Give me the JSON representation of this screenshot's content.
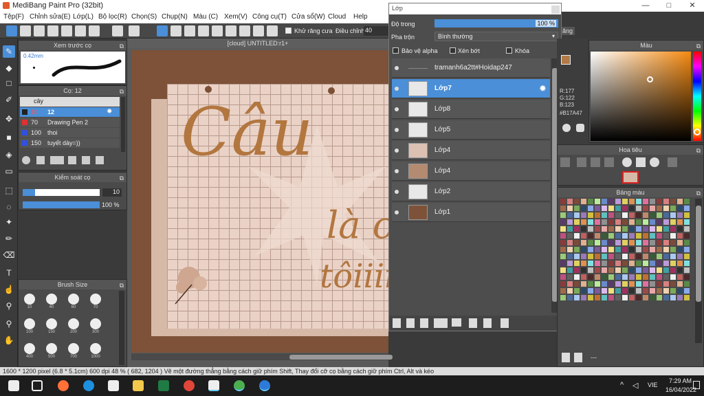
{
  "app": {
    "title": "MediBang Paint Pro (32bit)",
    "min": "—",
    "max": "□",
    "close": "✕"
  },
  "menu": [
    "Tệp(F)",
    "Chỉnh sửa(E)",
    "Lớp(L)",
    "Bộ lọc(R)",
    "Chọn(S)",
    "Chụp(N)",
    "Màu (C)",
    "Xem(V)",
    "Công cụ(T)",
    "Cửa sổ(W)",
    "Cloud",
    "Help"
  ],
  "toolbar": {
    "antialias": "Khử răng cưa",
    "adjust": "Điều chỉnh",
    "adjust_value": "40",
    "lang": "ăng"
  },
  "preview": {
    "title": "Xem trước cọ",
    "size": "0.42mm"
  },
  "brushes": {
    "title": "Cọ: 12",
    "group": "cây",
    "items": [
      {
        "size": "10",
        "name": "12",
        "color": "#222222"
      },
      {
        "size": "70",
        "name": "Drawing Pen 2",
        "color": "#e03030"
      },
      {
        "size": "100",
        "name": "thoi",
        "color": "#3050e0"
      },
      {
        "size": "150",
        "name": "tuyết dày=))",
        "color": "#3050e0"
      }
    ]
  },
  "control": {
    "title": "Kiểm soát cọ",
    "size_val": "10",
    "opacity_val": "100 %"
  },
  "brushsize": {
    "title": "Brush Size",
    "sizes": [
      "10",
      "40",
      "60",
      "70",
      "100",
      "150",
      "200",
      "300",
      "400",
      "500",
      "700",
      "1000"
    ]
  },
  "canvas": {
    "tab": "[cloud] UNTITLED:r1+",
    "text1": "Câu",
    "text2": "là c",
    "text3": "tôiiiii"
  },
  "layers": {
    "title": "Lớp",
    "opacity_label": "Độ trong",
    "opacity_val": "100 %",
    "blend_label": "Pha trộn",
    "blend_val": "Bình thường",
    "protect": "Bảo vệ alpha",
    "clip": "Xén bớt",
    "lock": "Khóa",
    "items": [
      "tramanh6a2tt#Hoidap247",
      "Lớp7",
      "Lớp8",
      "Lớp5",
      "Lớp4",
      "Lớp4",
      "Lớp2",
      "Lớp1"
    ]
  },
  "color": {
    "title": "Màu",
    "r": "R:177",
    "g": "G:122",
    "b": "B:123",
    "hex": "#B17A47"
  },
  "navigator": {
    "title": "Hoa tiêu"
  },
  "palette": {
    "title": "Bảng màu",
    "extra": "---"
  },
  "status": {
    "text": "1600 * 1200 pixel   (6.8 * 5.1cm)   600 dpi   48 %   ( 682, 1204 )   Vẽ một đường thẳng bằng cách giữ phím Shift, Thay đổi cỡ cọ bằng cách giữ phím Ctrl, Alt và kéo"
  },
  "taskbar": {
    "lang": "VIE",
    "time": "7:29 AM",
    "date": "16/04/2022"
  }
}
